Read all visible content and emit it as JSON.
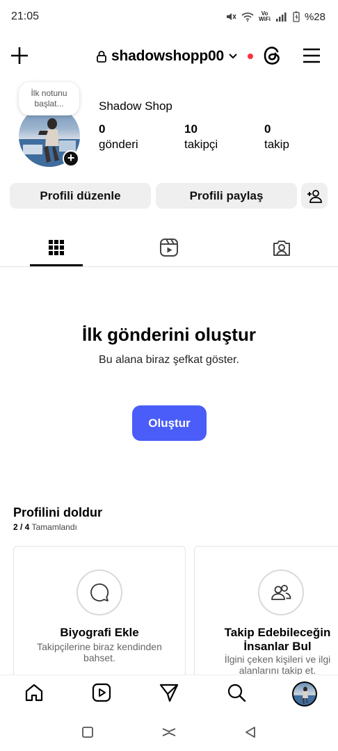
{
  "status_bar": {
    "time": "21:05",
    "vo": "Vo",
    "wifi_label": "WiFi",
    "battery": "%28"
  },
  "header": {
    "username": "shadowshopp00",
    "icons": [
      "plus-icon",
      "lock-icon",
      "chevron-down-icon",
      "threads-icon",
      "menu-icon"
    ]
  },
  "profile": {
    "note_placeholder": "İlk notunu başlat...",
    "display_name": "Shadow Shop",
    "stats": [
      {
        "value": "0",
        "label": "gönderi"
      },
      {
        "value": "10",
        "label": "takipçi"
      },
      {
        "value": "0",
        "label": "takip"
      }
    ]
  },
  "actions": {
    "edit_profile": "Profili düzenle",
    "share_profile": "Profili paylaş"
  },
  "tabs": [
    "grid-icon",
    "reels-icon",
    "tagged-icon"
  ],
  "empty_state": {
    "title": "İlk gönderini oluştur",
    "subtitle": "Bu alana biraz şefkat göster.",
    "button": "Oluştur"
  },
  "complete_profile": {
    "title": "Profilini doldur",
    "progress": "2 / 4",
    "progress_label": "Tamamlandı",
    "cards": [
      {
        "title": "Biyografi Ekle",
        "description": "Takipçilerine biraz kendinden bahset.",
        "icon": "chat-bubble-icon"
      },
      {
        "title": "Takip Edebileceğin İnsanlar Bul",
        "description": "İlgini çeken kişileri ve ilgi alanlarını takip et.",
        "icon": "people-icon"
      }
    ]
  },
  "colors": {
    "accent": "#4a5df9",
    "notification_dot": "#ff3040",
    "button_bg": "#efefef"
  }
}
